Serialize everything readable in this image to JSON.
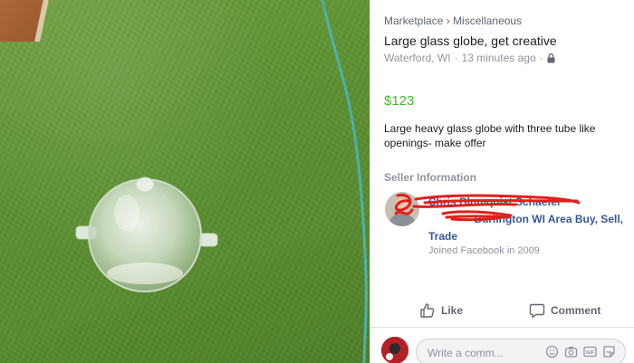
{
  "breadcrumb": {
    "marketplace": "Marketplace",
    "separator": "›",
    "category": "Miscellaneous"
  },
  "listing": {
    "title": "Large glass globe, get creative",
    "location": "Waterford, WI",
    "time": "13 minutes ago",
    "dot": "·",
    "price": "$123",
    "description": "Large heavy glass globe with three tube like openings- make offer"
  },
  "seller": {
    "heading": "Seller Information",
    "name": "Chris Blumquist Schaefer",
    "group_line1": "Burlington WI Area Buy, Sell,",
    "group_line2": "Trade",
    "joined": "Joined Facebook in 2009"
  },
  "actions": {
    "like": "Like",
    "comment": "Comment"
  },
  "composer": {
    "placeholder": "Write a comm..."
  },
  "colors": {
    "price": "#42b72a",
    "link": "#365899",
    "muted": "#90949c",
    "redaction": "#e0201c"
  },
  "icons": [
    "lock-icon",
    "like-icon",
    "comment-icon",
    "emoji-icon",
    "camera-icon",
    "gif-icon",
    "sticker-icon"
  ]
}
